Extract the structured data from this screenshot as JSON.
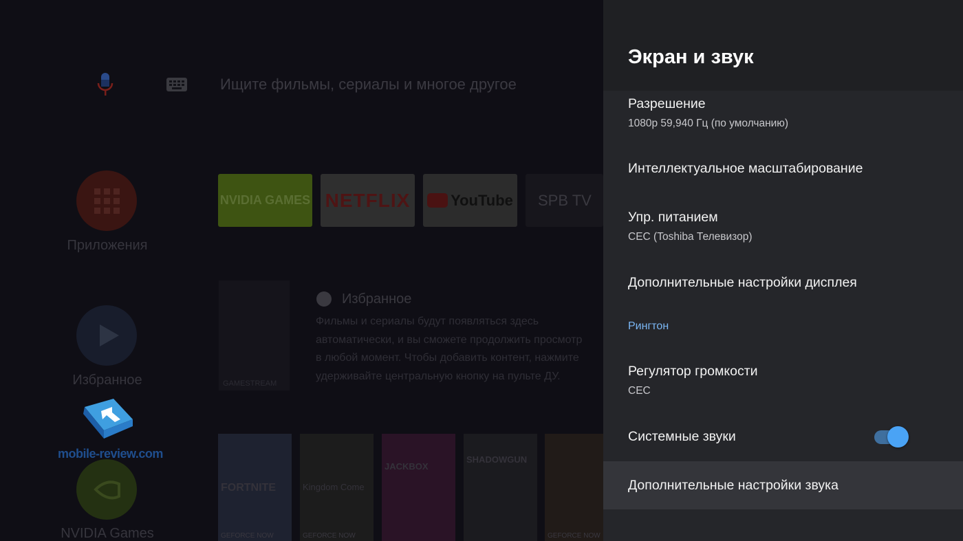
{
  "home": {
    "search_placeholder": "Ищите фильмы, сериалы и многое другое",
    "side": [
      {
        "label": "Приложения",
        "icon": "apps-grid-icon"
      },
      {
        "label": "Избранное",
        "icon": "play-icon"
      },
      {
        "label": "NVIDIA Games",
        "icon": "nvidia-icon"
      }
    ],
    "tiles": [
      {
        "label": "NVIDIA GAMES",
        "color": "#3e5412"
      },
      {
        "label": "NETFLIX",
        "color": "#2f2f2f"
      },
      {
        "label": "YouTube",
        "color": "#2c2c2c"
      },
      {
        "label": "SPB TV",
        "color": "#17161c"
      }
    ],
    "favorites": {
      "title": "Избранное",
      "text_lines": [
        "Фильмы и сериалы будут появляться здесь",
        "автоматически, и вы сможете продолжить просмотр",
        "в любой момент. Чтобы добавить контент, нажмите",
        "удерживайте центральную кнопку на пульте ДУ."
      ],
      "card_label": "GAMESTREAM"
    },
    "games": [
      {
        "title": "FORTNITE",
        "badge": "GEFORCE NOW"
      },
      {
        "title": "Kingdom Come",
        "badge": "GEFORCE NOW"
      },
      {
        "title": "JACKBOX",
        "badge": ""
      },
      {
        "title": "SHADOWGUN",
        "badge": ""
      },
      {
        "title": "",
        "badge": "GEFORCE NOW"
      }
    ],
    "watermark": "mobile-review.com"
  },
  "panel": {
    "title": "Экран и звук",
    "items": [
      {
        "label": "Разрешение",
        "sub": "1080p 59,940 Гц (по умолчанию)"
      },
      {
        "label": "Интеллектуальное масштабирование",
        "sub": ""
      },
      {
        "label": "Упр. питанием",
        "sub": "CEC (Toshiba Телевизор)"
      },
      {
        "label": "Дополнительные настройки дисплея",
        "sub": ""
      },
      {
        "label": "Регулятор громкости",
        "sub": "CEC"
      },
      {
        "label": "Системные звуки",
        "sub": ""
      },
      {
        "label": "Дополнительные настройки звука",
        "sub": ""
      }
    ],
    "section_ringtone": "Рингтон",
    "system_sounds_on": true,
    "colors": {
      "accent": "#4aa3f5",
      "section": "#7ab6f4"
    }
  }
}
